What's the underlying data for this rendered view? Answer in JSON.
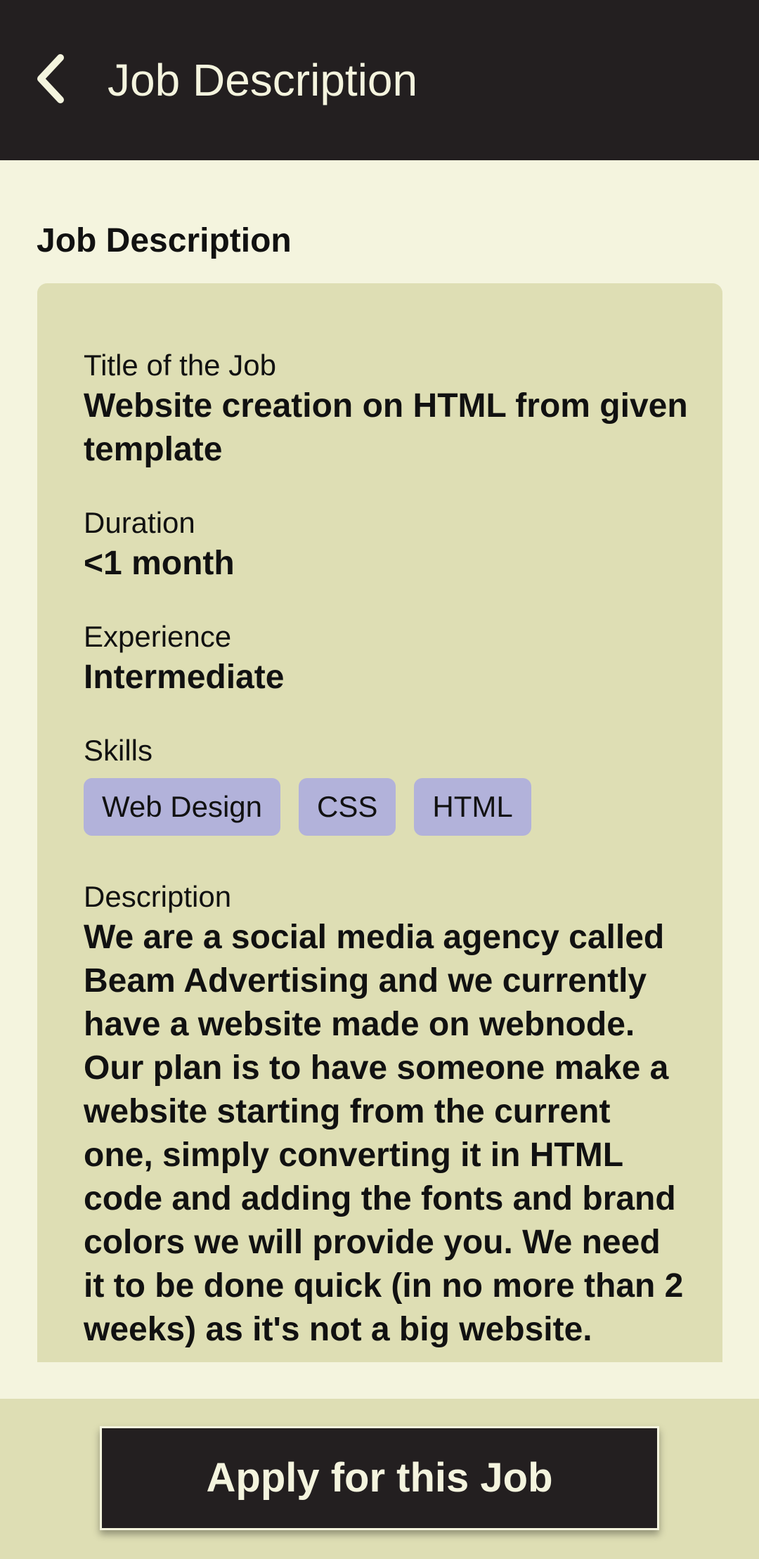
{
  "header": {
    "title": "Job Description",
    "back_icon": "chevron-left-icon"
  },
  "section": {
    "heading": "Job Description"
  },
  "job": {
    "title_label": "Title of the Job",
    "title_value": "Website creation on HTML from given template",
    "duration_label": "Duration",
    "duration_value": "<1 month",
    "experience_label": "Experience",
    "experience_value": "Intermediate",
    "skills_label": "Skills",
    "skills": [
      "Web Design",
      "CSS",
      "HTML"
    ],
    "description_label": "Description",
    "description_value": "We are a social media agency called Beam Advertising and we currently have a website made on webnode. Our plan is to have someone make a website starting from the current one, simply converting it in HTML code and adding the fonts and brand colors we will provide you. We need it to be done quick (in no more than 2 weeks) as it's not a big website."
  },
  "footer": {
    "apply_label": "Apply for this Job"
  },
  "colors": {
    "app_bar": "#231f20",
    "page_background": "#f4f4de",
    "card_background": "#dedeb4",
    "chip_background": "#b2b2da",
    "text_light": "#f4f4de",
    "text_dark": "#111111"
  }
}
